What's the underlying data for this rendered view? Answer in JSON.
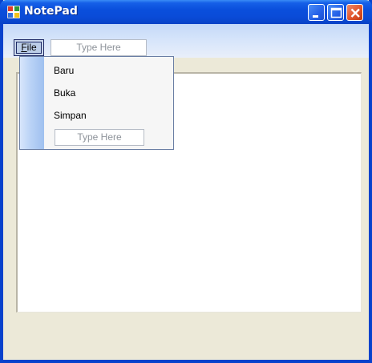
{
  "window": {
    "title": "NotePad",
    "colors": {
      "titlebar": "#0a4bd8",
      "close_button": "#e1552b",
      "background": "#ece9d8"
    }
  },
  "titlebar_buttons": {
    "minimize_icon": "minimize-icon",
    "maximize_icon": "maximize-icon",
    "close_icon": "close-icon"
  },
  "menubar": {
    "file": {
      "mnemonic": "F",
      "rest": "ile"
    },
    "placeholder": "Type Here"
  },
  "file_menu": {
    "items": [
      {
        "label": "Baru"
      },
      {
        "label": "Buka"
      },
      {
        "label": "Simpan"
      }
    ],
    "placeholder": "Type Here"
  },
  "editor": {
    "content": ""
  }
}
